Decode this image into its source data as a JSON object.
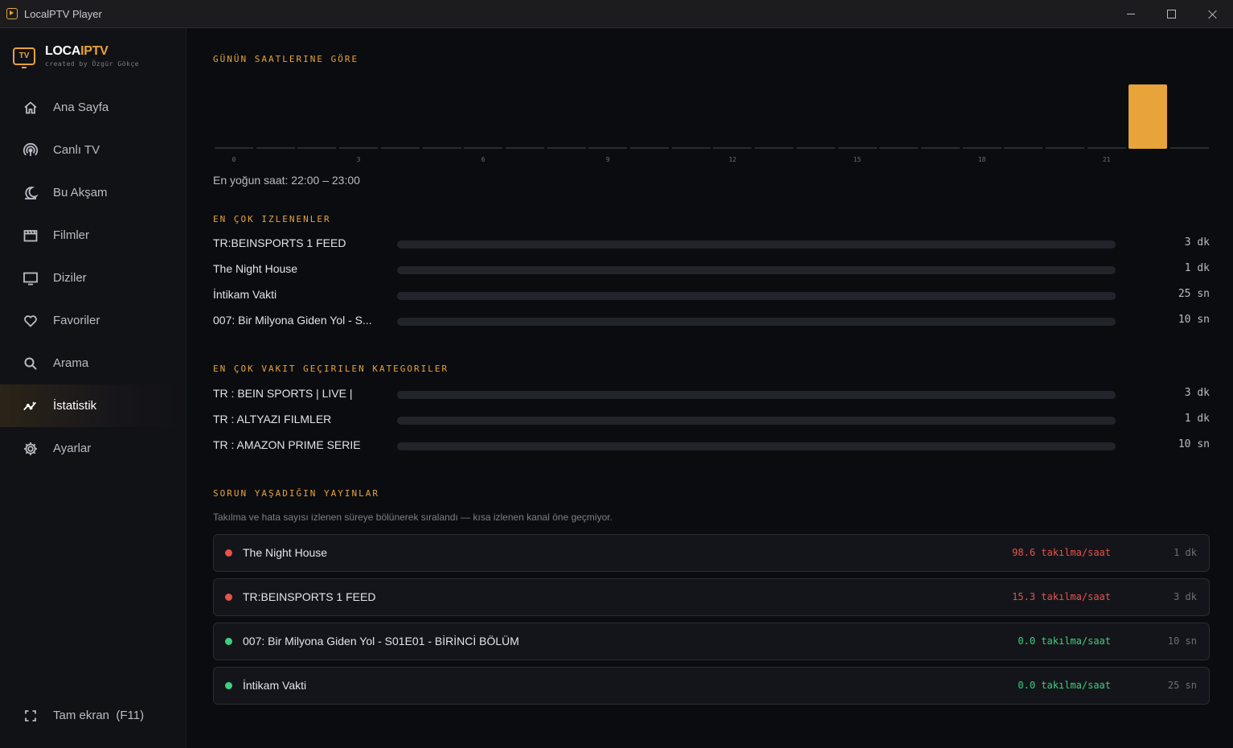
{
  "window": {
    "title": "LocalPTV Player"
  },
  "brand": {
    "name_part1": "LOCA",
    "name_part2": "IPTV",
    "logo_text": "TV",
    "subtitle": "created by Özgür Gökçe"
  },
  "nav": {
    "items": [
      {
        "label": "Ana Sayfa",
        "icon": "home-icon",
        "active": false
      },
      {
        "label": "Canlı TV",
        "icon": "broadcast-icon",
        "active": false
      },
      {
        "label": "Bu Akşam",
        "icon": "moon-icon",
        "active": false
      },
      {
        "label": "Filmler",
        "icon": "film-icon",
        "active": false
      },
      {
        "label": "Diziler",
        "icon": "tv-icon",
        "active": false
      },
      {
        "label": "Favoriler",
        "icon": "heart-icon",
        "active": false
      },
      {
        "label": "Arama",
        "icon": "search-icon",
        "active": false
      },
      {
        "label": "İstatistik",
        "icon": "stats-icon",
        "active": true
      },
      {
        "label": "Ayarlar",
        "icon": "gear-icon",
        "active": false
      }
    ],
    "fullscreen_label": "Tam ekran  (F11)"
  },
  "hours_section": {
    "title": "GÜNÜN SAATLERINE GÖRE",
    "tick_labels": [
      "0",
      "3",
      "6",
      "9",
      "12",
      "15",
      "18",
      "21"
    ],
    "values": [
      0,
      0,
      0,
      0,
      0,
      0,
      0,
      0,
      0,
      0,
      0,
      0,
      0,
      0,
      0,
      0,
      0,
      0,
      0,
      0,
      0,
      0,
      1,
      0
    ],
    "peak_text": "En yoğun saat: 22:00 – 23:00",
    "bar_color": "#e8a33a",
    "empty_color": "#2a2c33"
  },
  "most_watched": {
    "title": "EN ÇOK IZLENENLER",
    "items": [
      {
        "label": "TR:BEINSPORTS 1 FEED",
        "value": "3 dk",
        "fraction": 0
      },
      {
        "label": "The Night House",
        "value": "1 dk",
        "fraction": 0
      },
      {
        "label": "İntikam Vakti",
        "value": "25 sn",
        "fraction": 0
      },
      {
        "label": "007: Bir Milyona Giden Yol - S...",
        "value": "10 sn",
        "fraction": 0
      }
    ]
  },
  "categories": {
    "title": "EN ÇOK VAKIT GEÇIRILEN KATEGORILER",
    "items": [
      {
        "label": "TR : BEIN SPORTS | LIVE |",
        "value": "3 dk",
        "fraction": 0
      },
      {
        "label": "TR : ALTYAZI FILMLER",
        "value": "1 dk",
        "fraction": 0
      },
      {
        "label": "TR : AMAZON PRIME SERIE",
        "value": "10 sn",
        "fraction": 0
      }
    ]
  },
  "issues": {
    "title": "SORUN YAŞADIĞIN YAYINLAR",
    "note": "Takılma ve hata sayısı izlenen süreye bölünerek sıralandı — kısa izlenen kanal öne geçmiyor.",
    "items": [
      {
        "name": "The Night House",
        "rate": "98.6 takılma/saat",
        "duration": "1 dk",
        "status_color": "#e8534a"
      },
      {
        "name": "TR:BEINSPORTS 1 FEED",
        "rate": "15.3 takılma/saat",
        "duration": "3 dk",
        "status_color": "#e8534a"
      },
      {
        "name": "007: Bir Milyona Giden Yol - S01E01 - BİRİNCİ BÖLÜM",
        "rate": "0.0 takılma/saat",
        "duration": "10 sn",
        "status_color": "#3ecf7e"
      },
      {
        "name": "İntikam Vakti",
        "rate": "0.0 takılma/saat",
        "duration": "25 sn",
        "status_color": "#3ecf7e"
      }
    ]
  }
}
